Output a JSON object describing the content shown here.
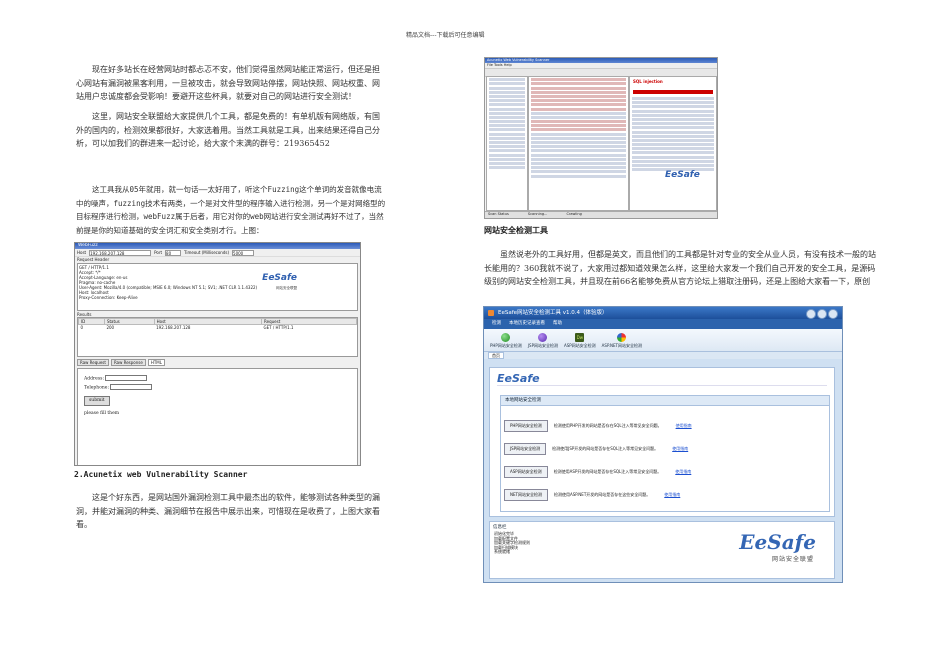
{
  "header": {
    "text": "精品文档---下载后可任意编辑"
  },
  "left": {
    "p1": "现在好多站长在经营网站时都忐忑不安，他们觉得虽然网站能正常运行，但还是担心网站有漏洞被黑客利用，一旦被攻击，就会导致网站停摆，网站快照、网站权重、网站用户忠诚度都会受影响！要避开这些杯具，就要对自己的网站进行安全测试！",
    "p2": "这里，网站安全联盟给大家提供几个工具，都是免费的！有单机版有网络版，有国外的国内的，检测效果都很好，大家选着用。当然工具就是工具，出来结果还得自己分析，可以加我们的群进来一起讨论，给大家个末满的群号：219365452",
    "p3": "这工具我从05年就用，就一句话——太好用了，听这个Fuzzing这个单词的发音就像电流中的噪声，fuzzing技术有两类，一个是对文件型的程序输入进行检测，另一个是对网络型的目标程序进行检测，webFuzz属于后者，用它对你的web网站进行安全测试再好不过了，当然前提是你的知道基础的安全词汇和安全类别才行。上图：",
    "heading2": "2.Acunetix web Vulnerability Scanner",
    "p4": "这是个好东西，是网站国外漏洞检测工具中最杰出的软件，能够测试各种类型的漏洞，并能对漏洞的种类、漏洞细节在报告中展示出来，可惜现在是收费了，上图大家看看。"
  },
  "right": {
    "heading": "网站安全检测工具",
    "p1": "虽然说老外的工具好用，但都是英文，而且他们的工具都是针对专业的安全从业人员，有没有技术一般的站长能用的？360我就不说了，大家用过都知道效果怎么样，这里给大家发一个我们自己开发的安全工具，是源码级别的网站安全检测工具，并且现在前66名能够免费从官方论坛上猎取注册码，还是上图给大家看一下，原创"
  },
  "webfuzz": {
    "title": "WebFuzz",
    "host_label": "Host",
    "host_value": "192.168.207.128",
    "port_label": "Port",
    "port_value": "80",
    "timeout_label": "Timeout (Milliseconds)",
    "timeout_value": "5000",
    "request_header_label": "Request Header",
    "request_lines": [
      "GET / HTTP/1.1",
      "Accept: */*",
      "Accept-Language: en-us",
      "Pragma: no-cache",
      "User-Agent: Mozilla/4.0 (compatible; MSIE 6.0; Windows NT 5.1; SV1; .NET CLR 1.1.4322)",
      "Host: localhost",
      "Proxy-Connection: Keep-Alive"
    ],
    "logo": "EeSafe",
    "logo_sub": "网站安全联盟",
    "results_label": "Results",
    "table_headers": [
      "ID",
      "Status",
      "Host",
      "Request"
    ],
    "table_row": [
      "0",
      "200",
      "192.168.207.128",
      "GET / HTTP/1.1"
    ],
    "tabs": [
      "Raw Request",
      "Raw Response",
      "HTML"
    ],
    "form_address": "Address:",
    "form_telephone": "Telephone:",
    "form_button": "submit",
    "form_note": "please fill them"
  },
  "acunetix": {
    "title": "Acunetix Web Vulnerability Scanner",
    "menu": "File   Tools   Help",
    "alert_title": "SQL injection",
    "logo": "EeSafe",
    "status_items": [
      "Scan Status",
      "Scanning...",
      "Crawling"
    ]
  },
  "eesafe": {
    "title": "EeSafe网站安全检测工具 v1.0.4（体验版）",
    "menu": [
      "检测",
      "本地历史记录查看",
      "帮助"
    ],
    "tools": [
      "PHP网站安全检测",
      "JSP网站安全检测",
      "ASP网站安全检测",
      "ASP.NET网站安全检测"
    ],
    "tab": "首页",
    "logo": "EeSafe",
    "panel_title": "本地网站安全检测",
    "checks": [
      {
        "button": "PHP网站安全检测",
        "desc": "检测使用PHP开发的网站是否存在SQL注入等常见安全问题。",
        "link": "使用指南"
      },
      {
        "button": "JSP网站安全检测",
        "desc": "检测使用JSP开发的网站是否存在SQL注入等常见安全问题。",
        "link": "使用指南"
      },
      {
        "button": "ASP网站安全检测",
        "desc": "检测使用ASP开发的网站是否存在SQL注入等常见安全问题。",
        "link": "使用指南"
      },
      {
        "button": "NET网站安全检测",
        "desc": "检测使用ASP.NET开发的网站是否存在这些安全问题。",
        "link": "使用指南"
      }
    ],
    "log_title": "信息栏",
    "log_lines": [
      "初始化完毕",
      "加载配置文件",
      "加载关键字检测规则",
      "加载扫描模块",
      "系统就绪"
    ],
    "big_logo": "EeSafe",
    "big_logo_sub": "网站安全联盟"
  }
}
